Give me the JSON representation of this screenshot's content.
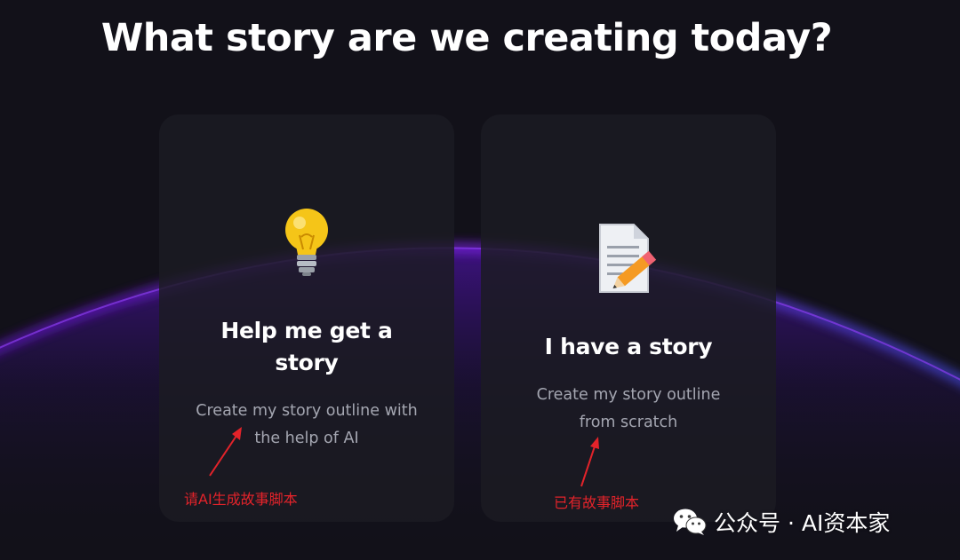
{
  "page": {
    "title": "What story are we creating today?"
  },
  "options": [
    {
      "title": "Help me get a story",
      "description": "Create my story outline with the help of AI",
      "icon": "lightbulb-icon",
      "annotation": "请AI生成故事脚本"
    },
    {
      "title": "I have a story",
      "description": "Create my story outline from scratch",
      "icon": "memo-pencil-icon",
      "annotation": "已有故事脚本"
    }
  ],
  "watermark": {
    "text": "公众号 · AI资本家",
    "icon": "wechat-icon"
  },
  "colors": {
    "background": "#121119",
    "card": "#1b1b22",
    "glow": "#6a1fd0",
    "annotation": "#e3232a",
    "description": "#a4a6b1"
  }
}
